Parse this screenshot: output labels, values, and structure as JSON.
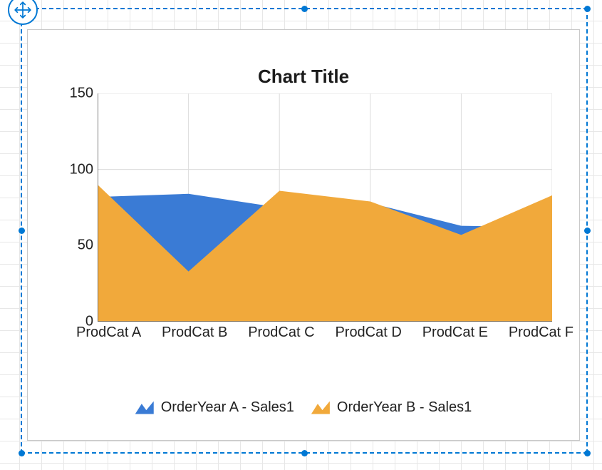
{
  "ui": {
    "platform": "report-designer",
    "move_icon": "move-arrows-icon"
  },
  "chart_data": {
    "type": "area",
    "title": "Chart Title",
    "categories": [
      "ProdCat A",
      "ProdCat B",
      "ProdCat C",
      "ProdCat D",
      "ProdCat E",
      "ProdCat F"
    ],
    "series": [
      {
        "name": "OrderYear A - Sales1",
        "color": "#3a7bd5",
        "values": [
          82,
          84,
          75,
          78,
          63,
          62
        ]
      },
      {
        "name": "OrderYear B - Sales1",
        "color": "#f1a93b",
        "values": [
          90,
          33,
          86,
          79,
          57,
          83
        ]
      }
    ],
    "xlabel": "",
    "ylabel": "",
    "ylim": [
      0,
      150
    ],
    "yticks": [
      0,
      50,
      100,
      150
    ],
    "grid": {
      "x": true,
      "y": true
    }
  },
  "legend": {
    "items": [
      {
        "label": "OrderYear A - Sales1",
        "key": "a"
      },
      {
        "label": "OrderYear B - Sales1",
        "key": "b"
      }
    ]
  }
}
